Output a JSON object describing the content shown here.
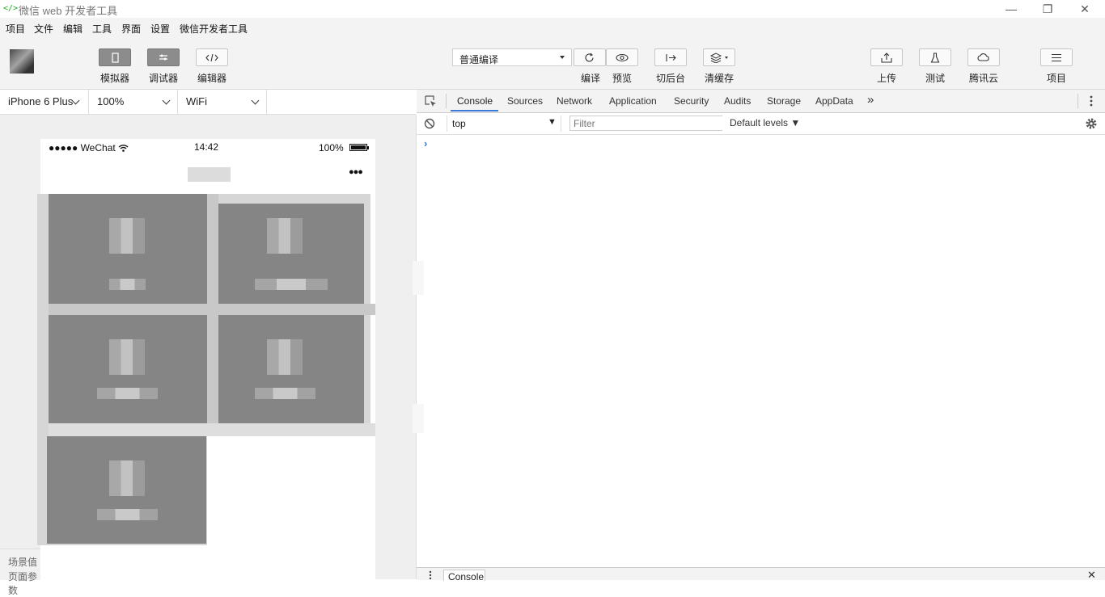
{
  "window": {
    "logo": "</>",
    "title": "微信 web 开发者工具"
  },
  "menu": {
    "items": [
      "项目",
      "文件",
      "编辑",
      "工具",
      "界面",
      "设置",
      "微信开发者工具"
    ]
  },
  "toolbar": {
    "simulator_label": "模拟器",
    "debugger_label": "调试器",
    "editor_label": "编辑器",
    "compile_mode": "普通编译",
    "compile_label": "编译",
    "preview_label": "预览",
    "background_label": "切后台",
    "clear_cache_label": "清缓存",
    "upload_label": "上传",
    "test_label": "测试",
    "cloud_label": "腾讯云",
    "project_label": "项目"
  },
  "device_bar": {
    "device": "iPhone 6 Plus",
    "zoom": "100%",
    "network": "WiFi"
  },
  "phone": {
    "carrier": "●●●●● WeChat",
    "time": "14:42",
    "battery": "100%",
    "more": "●●●"
  },
  "scene": {
    "label1": "场景值",
    "label2": "页面参数"
  },
  "devtools": {
    "tabs": [
      "Console",
      "Sources",
      "Network",
      "Application",
      "Security",
      "Audits",
      "Storage",
      "AppData"
    ],
    "overflow": "»",
    "context": "top",
    "filter_placeholder": "Filter",
    "levels": "Default levels ▼",
    "prompt": "›",
    "drawer_tab": "Console"
  },
  "colors": {
    "accent": "#3879d9",
    "brand": "#1aad19"
  }
}
